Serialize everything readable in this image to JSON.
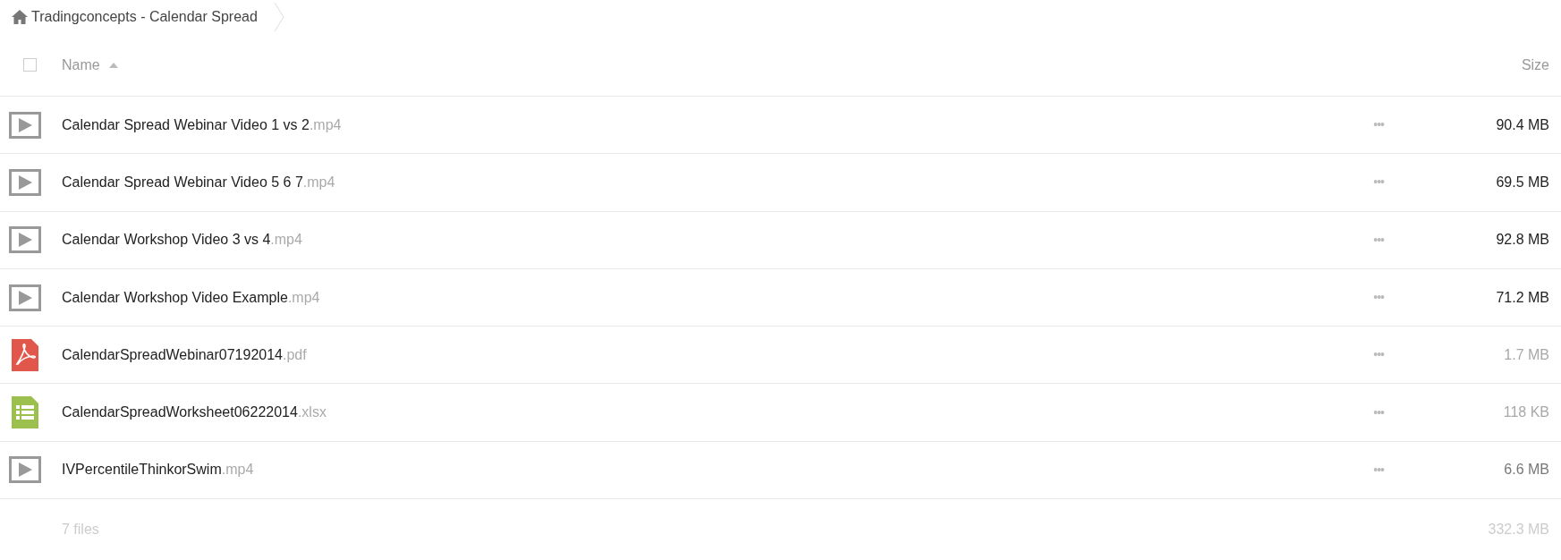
{
  "breadcrumb": {
    "label": "Tradingconcepts - Calendar Spread"
  },
  "header": {
    "select_all": {
      "checked": false
    },
    "name": "Name",
    "size": "Size",
    "sort_ascending": true
  },
  "files": [
    {
      "kind": "video",
      "name": "Calendar Spread Webinar Video 1 vs 2",
      "ext": ".mp4",
      "menu": "•••",
      "size": "90.4 MB",
      "color": "#222222"
    },
    {
      "kind": "video",
      "name": "Calendar Spread Webinar Video 5 6 7",
      "ext": ".mp4",
      "menu": "•••",
      "size": "69.5 MB",
      "color": "#222222"
    },
    {
      "kind": "video",
      "name": "Calendar Workshop Video 3 vs 4",
      "ext": ".mp4",
      "menu": "•••",
      "size": "92.8 MB",
      "color": "#222222"
    },
    {
      "kind": "video",
      "name": "Calendar Workshop Video Example",
      "ext": ".mp4",
      "menu": "•••",
      "size": "71.2 MB",
      "color": "#222222"
    },
    {
      "kind": "pdf",
      "name": "CalendarSpreadWebinar07192014",
      "ext": ".pdf",
      "menu": "•••",
      "size": "1.7 MB",
      "color": "#a8a8a8"
    },
    {
      "kind": "spreadsheet",
      "name": "CalendarSpreadWorksheet06222014",
      "ext": ".xlsx",
      "menu": "•••",
      "size": "118 KB",
      "color": "#a8a8a8"
    },
    {
      "kind": "video",
      "name": "IVPercentileThinkorSwim",
      "ext": ".mp4",
      "menu": "•••",
      "size": "6.6 MB",
      "color": "#777777"
    }
  ],
  "footer": {
    "count": "7 files",
    "total": "332.3 MB"
  }
}
